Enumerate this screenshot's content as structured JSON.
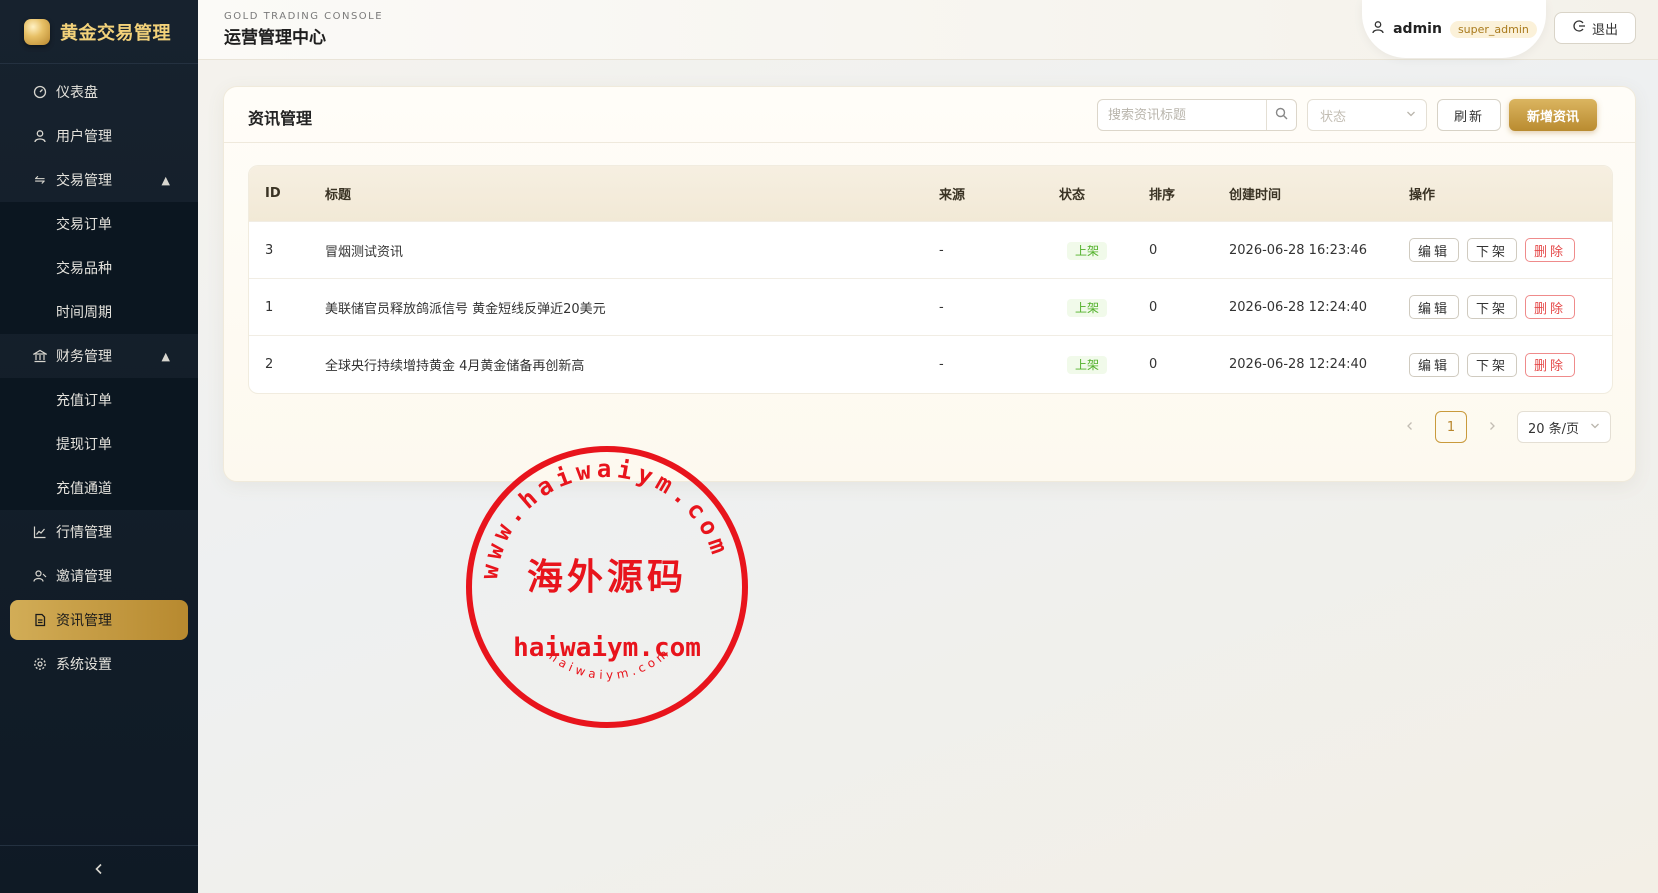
{
  "sidebar": {
    "brand": "黄金交易管理",
    "items": [
      {
        "label": "仪表盘",
        "icon": "dashboard-icon"
      },
      {
        "label": "用户管理",
        "icon": "user-icon"
      },
      {
        "label": "交易管理",
        "icon": "swap-icon",
        "children": [
          "交易订单",
          "交易品种",
          "时间周期"
        ]
      },
      {
        "label": "财务管理",
        "icon": "bank-icon",
        "children": [
          "充值订单",
          "提现订单",
          "充值通道"
        ]
      },
      {
        "label": "行情管理",
        "icon": "chart-line-icon"
      },
      {
        "label": "邀请管理",
        "icon": "invite-icon"
      },
      {
        "label": "资讯管理",
        "icon": "document-icon",
        "active": true
      },
      {
        "label": "系统设置",
        "icon": "gear-icon"
      }
    ]
  },
  "header": {
    "subtitle": "GOLD TRADING CONSOLE",
    "title": "运营管理中心",
    "username": "admin",
    "role": "super_admin",
    "logout_label": "退出"
  },
  "card": {
    "title": "资讯管理",
    "search_placeholder": "搜索资讯标题",
    "status_placeholder": "状态",
    "refresh_label": "刷新",
    "add_label": "新增资讯"
  },
  "table": {
    "columns": [
      "ID",
      "标题",
      "来源",
      "状态",
      "排序",
      "创建时间",
      "操作"
    ],
    "rows": [
      {
        "id": "3",
        "title": "冒烟测试资讯",
        "source": "-",
        "status": "上架",
        "sort": "0",
        "created": "2026-06-28 16:23:46"
      },
      {
        "id": "1",
        "title": "美联储官员释放鸽派信号 黄金短线反弹近20美元",
        "source": "-",
        "status": "上架",
        "sort": "0",
        "created": "2026-06-28 12:24:40"
      },
      {
        "id": "2",
        "title": "全球央行持续增持黄金 4月黄金储备再创新高",
        "source": "-",
        "status": "上架",
        "sort": "0",
        "created": "2026-06-28 12:24:40"
      }
    ],
    "ops": {
      "edit": "编辑",
      "offline": "下架",
      "delete": "删除"
    }
  },
  "pager": {
    "current_page": "1",
    "page_size": "20 条/页"
  },
  "watermark": {
    "ring_text": "www.haiwaiym.com",
    "center_text": "海外源码",
    "domain": "haiwaiym.com",
    "bottom_small": "haiwaiym.com",
    "color": "#e8141c"
  },
  "colors": {
    "gold": "#c99a3c",
    "sidebar": "#17222e",
    "success": "#52b12b",
    "danger": "#e54848"
  }
}
